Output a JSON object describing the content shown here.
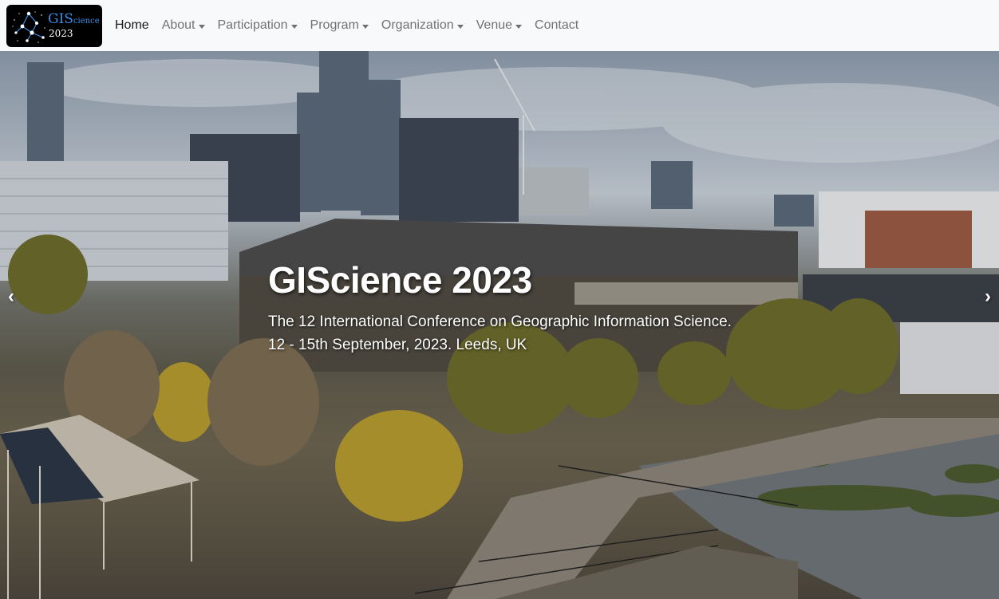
{
  "navbar": {
    "logo": {
      "title_main": "GIS",
      "title_small": "cience",
      "year": "2023"
    },
    "items": [
      {
        "label": "Home",
        "dropdown": false,
        "active": true
      },
      {
        "label": "About",
        "dropdown": true,
        "active": false
      },
      {
        "label": "Participation",
        "dropdown": true,
        "active": false
      },
      {
        "label": "Program",
        "dropdown": true,
        "active": false
      },
      {
        "label": "Organization",
        "dropdown": true,
        "active": false
      },
      {
        "label": "Venue",
        "dropdown": true,
        "active": false
      },
      {
        "label": "Contact",
        "dropdown": false,
        "active": false
      }
    ]
  },
  "hero": {
    "title": "GIScience 2023",
    "subtitle_line1": "The 12 International Conference on Geographic Information Science.",
    "subtitle_line2": "12 - 15th September, 2023. Leeds, UK",
    "prev_icon": "chevron-left-icon",
    "next_icon": "chevron-right-icon",
    "prev_glyph": "‹",
    "next_glyph": "›"
  },
  "colors": {
    "navbar_bg": "#f8f9fa",
    "nav_text": "#6c6c6c",
    "nav_active": "#1a1a1a",
    "logo_bg": "#000000",
    "logo_accent": "#3a8ee6",
    "caption_text": "#ffffff"
  }
}
